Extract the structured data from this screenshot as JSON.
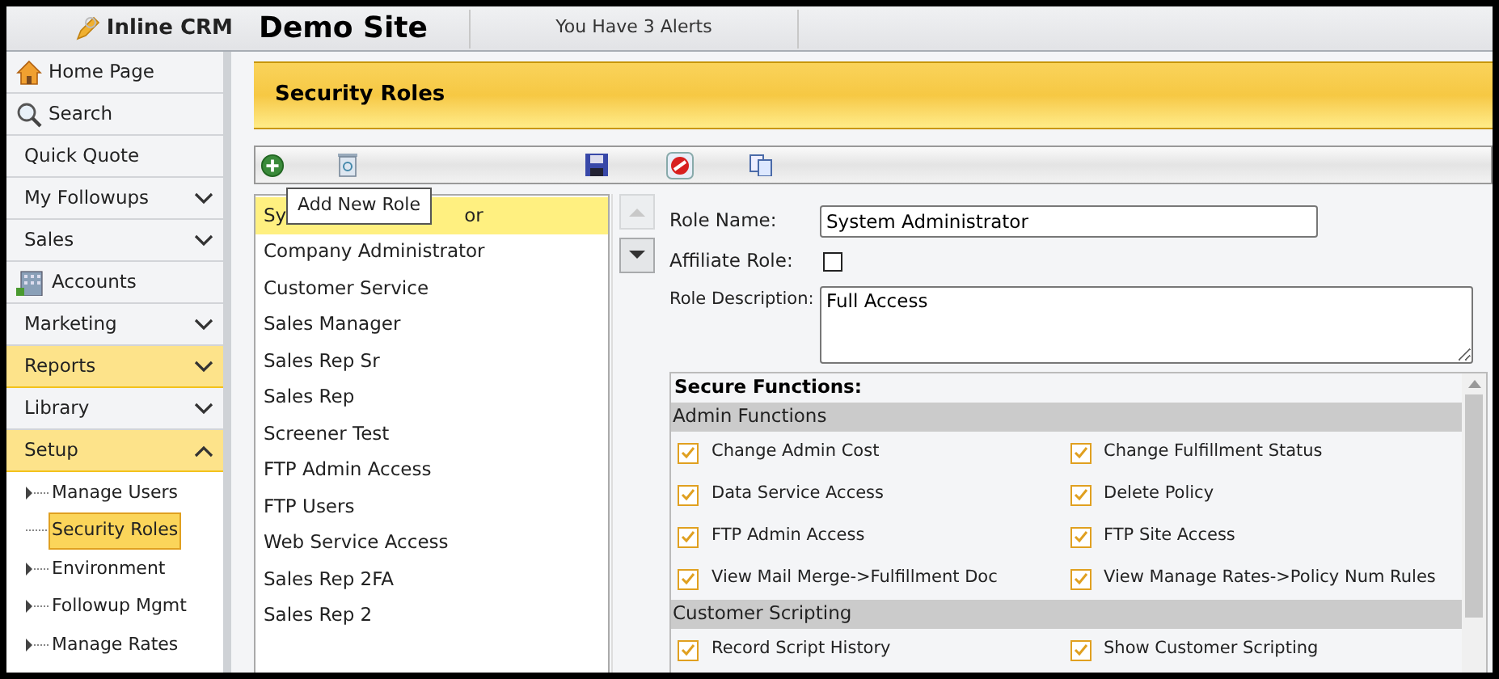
{
  "header": {
    "app_name": "Inline CRM",
    "site": "Demo Site",
    "alerts": "You Have 3 Alerts"
  },
  "sidebar": {
    "items": [
      {
        "label": "Home Page",
        "kind": "home",
        "highlighted": false
      },
      {
        "label": "Search",
        "kind": "search",
        "highlighted": false
      },
      {
        "label": "Quick Quote",
        "kind": "plain",
        "highlighted": false
      },
      {
        "label": "My Followups",
        "kind": "menu",
        "expanded": false,
        "highlighted": false
      },
      {
        "label": "Sales",
        "kind": "menu",
        "expanded": false,
        "highlighted": false
      },
      {
        "label": "Accounts",
        "kind": "building",
        "highlighted": false
      },
      {
        "label": "Marketing",
        "kind": "menu",
        "expanded": false,
        "highlighted": false
      },
      {
        "label": "Reports",
        "kind": "menu",
        "expanded": false,
        "highlighted": true
      },
      {
        "label": "Library",
        "kind": "menu",
        "expanded": false,
        "highlighted": false
      },
      {
        "label": "Setup",
        "kind": "menu",
        "expanded": true,
        "highlighted": true,
        "children": [
          {
            "label": "Manage Users",
            "has_children": true,
            "selected": false
          },
          {
            "label": "Security Roles",
            "has_children": false,
            "selected": true
          },
          {
            "label": "Environment",
            "has_children": true,
            "selected": false
          },
          {
            "label": "Followup Mgmt",
            "has_children": true,
            "selected": false
          },
          {
            "label": "Manage Rates",
            "has_children": true,
            "selected": false
          }
        ]
      }
    ]
  },
  "page": {
    "title": "Security Roles"
  },
  "toolbar": {
    "tooltip": "Add New Role"
  },
  "roles": [
    {
      "label": "Sy",
      "label_tail": "or",
      "selected": true
    },
    {
      "label": "Company Administrator",
      "selected": false
    },
    {
      "label": "Customer Service",
      "selected": false
    },
    {
      "label": "Sales Manager",
      "selected": false
    },
    {
      "label": "Sales Rep Sr",
      "selected": false
    },
    {
      "label": "Sales Rep",
      "selected": false
    },
    {
      "label": "Screener Test",
      "selected": false
    },
    {
      "label": "FTP Admin Access",
      "selected": false
    },
    {
      "label": "FTP Users",
      "selected": false
    },
    {
      "label": "Web Service Access",
      "selected": false
    },
    {
      "label": "Sales Rep 2FA",
      "selected": false
    },
    {
      "label": "Sales Rep 2",
      "selected": false
    }
  ],
  "form": {
    "role_name_label": "Role Name:",
    "role_name": "System Administrator",
    "affiliate_label": "Affiliate Role:",
    "affiliate_checked": false,
    "description_label": "Role Description:",
    "description": "Full Access"
  },
  "secure_functions": {
    "title": "Secure Functions:",
    "groups": [
      {
        "name": "Admin Functions",
        "items": [
          {
            "label": "Change Admin Cost",
            "checked": true
          },
          {
            "label": "Change Fulfillment Status",
            "checked": true
          },
          {
            "label": "Data Service Access",
            "checked": true
          },
          {
            "label": "Delete Policy",
            "checked": true
          },
          {
            "label": "FTP Admin Access",
            "checked": true
          },
          {
            "label": "FTP Site Access",
            "checked": true
          },
          {
            "label": "View Mail Merge->Fulfillment Doc",
            "checked": true
          },
          {
            "label": "View Manage Rates->Policy Num Rules",
            "checked": true
          }
        ]
      },
      {
        "name": "Customer Scripting",
        "items": [
          {
            "label": "Record Script History",
            "checked": true
          },
          {
            "label": "Show Customer Scripting",
            "checked": true
          }
        ]
      }
    ]
  }
}
